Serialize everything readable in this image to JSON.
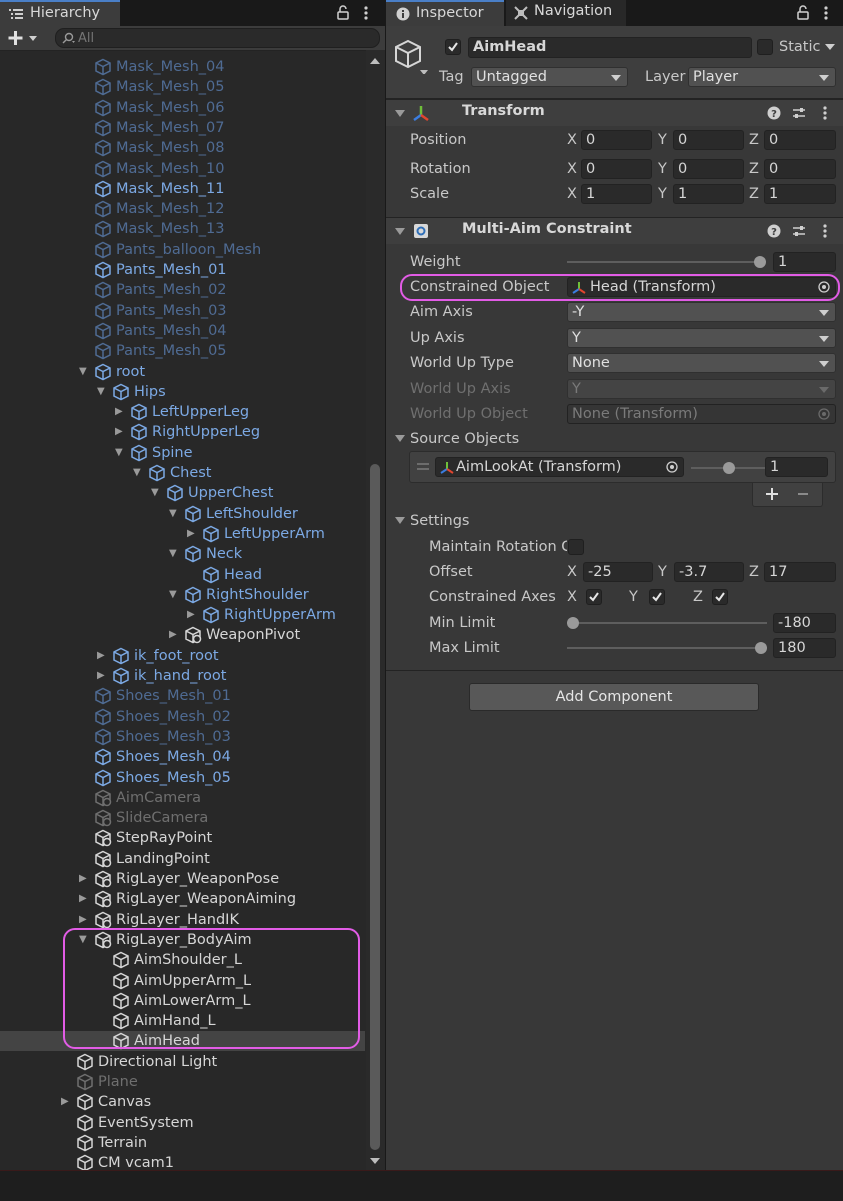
{
  "hierarchy": {
    "tab_label": "Hierarchy",
    "search_placeholder": "All",
    "rows": [
      {
        "label": "Mask_Mesh_04",
        "indent": 0,
        "color": "dblue",
        "arrow": "",
        "icon": "cube"
      },
      {
        "label": "Mask_Mesh_05",
        "indent": 0,
        "color": "dblue",
        "arrow": "",
        "icon": "cube"
      },
      {
        "label": "Mask_Mesh_06",
        "indent": 0,
        "color": "dblue",
        "arrow": "",
        "icon": "cube"
      },
      {
        "label": "Mask_Mesh_07",
        "indent": 0,
        "color": "dblue",
        "arrow": "",
        "icon": "cube"
      },
      {
        "label": "Mask_Mesh_08",
        "indent": 0,
        "color": "dblue",
        "arrow": "",
        "icon": "cube"
      },
      {
        "label": "Mask_Mesh_10",
        "indent": 0,
        "color": "dblue",
        "arrow": "",
        "icon": "cube"
      },
      {
        "label": "Mask_Mesh_11",
        "indent": 0,
        "color": "blue",
        "arrow": "",
        "icon": "cube"
      },
      {
        "label": "Mask_Mesh_12",
        "indent": 0,
        "color": "dblue",
        "arrow": "",
        "icon": "cube"
      },
      {
        "label": "Mask_Mesh_13",
        "indent": 0,
        "color": "dblue",
        "arrow": "",
        "icon": "cube"
      },
      {
        "label": "Pants_balloon_Mesh",
        "indent": 0,
        "color": "dblue",
        "arrow": "",
        "icon": "cube"
      },
      {
        "label": "Pants_Mesh_01",
        "indent": 0,
        "color": "blue",
        "arrow": "",
        "icon": "cube"
      },
      {
        "label": "Pants_Mesh_02",
        "indent": 0,
        "color": "dblue",
        "arrow": "",
        "icon": "cube"
      },
      {
        "label": "Pants_Mesh_03",
        "indent": 0,
        "color": "dblue",
        "arrow": "",
        "icon": "cube"
      },
      {
        "label": "Pants_Mesh_04",
        "indent": 0,
        "color": "dblue",
        "arrow": "",
        "icon": "cube"
      },
      {
        "label": "Pants_Mesh_05",
        "indent": 0,
        "color": "dblue",
        "arrow": "",
        "icon": "cube"
      },
      {
        "label": "root",
        "indent": 0,
        "color": "blue",
        "arrow": "down",
        "icon": "cube"
      },
      {
        "label": "Hips",
        "indent": 1,
        "color": "blue",
        "arrow": "down",
        "icon": "cube"
      },
      {
        "label": "LeftUpperLeg",
        "indent": 2,
        "color": "blue",
        "arrow": "right",
        "icon": "cube"
      },
      {
        "label": "RightUpperLeg",
        "indent": 2,
        "color": "blue",
        "arrow": "right",
        "icon": "cube"
      },
      {
        "label": "Spine",
        "indent": 2,
        "color": "blue",
        "arrow": "down",
        "icon": "cube"
      },
      {
        "label": "Chest",
        "indent": 3,
        "color": "blue",
        "arrow": "down",
        "icon": "cube"
      },
      {
        "label": "UpperChest",
        "indent": 4,
        "color": "blue",
        "arrow": "down",
        "icon": "cube"
      },
      {
        "label": "LeftShoulder",
        "indent": 5,
        "color": "blue",
        "arrow": "down",
        "icon": "cube"
      },
      {
        "label": "LeftUpperArm",
        "indent": 6,
        "color": "blue",
        "arrow": "right",
        "icon": "cube"
      },
      {
        "label": "Neck",
        "indent": 5,
        "color": "blue",
        "arrow": "down",
        "icon": "cube"
      },
      {
        "label": "Head",
        "indent": 6,
        "color": "blue",
        "arrow": "",
        "icon": "cube"
      },
      {
        "label": "RightShoulder",
        "indent": 5,
        "color": "blue",
        "arrow": "down",
        "icon": "cube"
      },
      {
        "label": "RightUpperArm",
        "indent": 6,
        "color": "blue",
        "arrow": "right",
        "icon": "cube"
      },
      {
        "label": "WeaponPivot",
        "indent": 5,
        "color": "white",
        "arrow": "right",
        "icon": "cube-gear"
      },
      {
        "label": "ik_foot_root",
        "indent": 1,
        "color": "blue",
        "arrow": "right",
        "icon": "cube"
      },
      {
        "label": "ik_hand_root",
        "indent": 1,
        "color": "blue",
        "arrow": "right",
        "icon": "cube"
      },
      {
        "label": "Shoes_Mesh_01",
        "indent": 0,
        "color": "dblue",
        "arrow": "",
        "icon": "cube"
      },
      {
        "label": "Shoes_Mesh_02",
        "indent": 0,
        "color": "dblue",
        "arrow": "",
        "icon": "cube"
      },
      {
        "label": "Shoes_Mesh_03",
        "indent": 0,
        "color": "dblue",
        "arrow": "",
        "icon": "cube"
      },
      {
        "label": "Shoes_Mesh_04",
        "indent": 0,
        "color": "blue",
        "arrow": "",
        "icon": "cube"
      },
      {
        "label": "Shoes_Mesh_05",
        "indent": 0,
        "color": "blue",
        "arrow": "",
        "icon": "cube"
      },
      {
        "label": "AimCamera",
        "indent": 0,
        "color": "gray",
        "arrow": "",
        "icon": "cube-gear"
      },
      {
        "label": "SlideCamera",
        "indent": 0,
        "color": "gray",
        "arrow": "",
        "icon": "cube-gear"
      },
      {
        "label": "StepRayPoint",
        "indent": 0,
        "color": "white",
        "arrow": "",
        "icon": "cube-gear"
      },
      {
        "label": "LandingPoint",
        "indent": 0,
        "color": "white",
        "arrow": "",
        "icon": "cube-gear"
      },
      {
        "label": "RigLayer_WeaponPose",
        "indent": 0,
        "color": "white",
        "arrow": "right",
        "icon": "cube-gear"
      },
      {
        "label": "RigLayer_WeaponAiming",
        "indent": 0,
        "color": "white",
        "arrow": "right",
        "icon": "cube-gear"
      },
      {
        "label": "RigLayer_HandIK",
        "indent": 0,
        "color": "white",
        "arrow": "right",
        "icon": "cube-gear"
      },
      {
        "label": "RigLayer_BodyAim",
        "indent": 0,
        "color": "white",
        "arrow": "down",
        "icon": "cube-gear"
      },
      {
        "label": "AimShoulder_L",
        "indent": 1,
        "color": "white",
        "arrow": "",
        "icon": "cube"
      },
      {
        "label": "AimUpperArm_L",
        "indent": 1,
        "color": "white",
        "arrow": "",
        "icon": "cube"
      },
      {
        "label": "AimLowerArm_L",
        "indent": 1,
        "color": "white",
        "arrow": "",
        "icon": "cube"
      },
      {
        "label": "AimHand_L",
        "indent": 1,
        "color": "white",
        "arrow": "",
        "icon": "cube"
      },
      {
        "label": "AimHead",
        "indent": 1,
        "color": "white",
        "arrow": "",
        "icon": "cube",
        "selected": true
      },
      {
        "label": "Directional Light",
        "indent": -1,
        "color": "white",
        "arrow": "",
        "icon": "cube"
      },
      {
        "label": "Plane",
        "indent": -1,
        "color": "gray",
        "arrow": "",
        "icon": "cube"
      },
      {
        "label": "Canvas",
        "indent": -1,
        "color": "white",
        "arrow": "right",
        "icon": "cube"
      },
      {
        "label": "EventSystem",
        "indent": -1,
        "color": "white",
        "arrow": "",
        "icon": "cube"
      },
      {
        "label": "Terrain",
        "indent": -1,
        "color": "white",
        "arrow": "",
        "icon": "cube"
      },
      {
        "label": "CM vcam1",
        "indent": -1,
        "color": "white",
        "arrow": "",
        "icon": "cube"
      }
    ]
  },
  "inspector": {
    "tab_label": "Inspector",
    "nav_tab_label": "Navigation",
    "object_name": "AimHead",
    "static_label": "Static",
    "tag_label": "Tag",
    "tag_value": "Untagged",
    "layer_label": "Layer",
    "layer_value": "Player",
    "transform": {
      "title": "Transform",
      "position_label": "Position",
      "rotation_label": "Rotation",
      "scale_label": "Scale",
      "position": {
        "x": "0",
        "y": "0",
        "z": "0"
      },
      "rotation": {
        "x": "0",
        "y": "0",
        "z": "0"
      },
      "scale": {
        "x": "1",
        "y": "1",
        "z": "1"
      }
    },
    "axis_x": "X",
    "axis_y": "Y",
    "axis_z": "Z",
    "constraint": {
      "title": "Multi-Aim Constraint",
      "weight_label": "Weight",
      "weight_value": "1",
      "weight_fraction": 1.0,
      "constrained_object_label": "Constrained Object",
      "constrained_object_value": "Head (Transform)",
      "aim_axis_label": "Aim Axis",
      "aim_axis_value": "-Y",
      "up_axis_label": "Up Axis",
      "up_axis_value": "Y",
      "world_up_type_label": "World Up Type",
      "world_up_type_value": "None",
      "world_up_axis_label": "World Up Axis",
      "world_up_axis_value": "Y",
      "world_up_object_label": "World Up Object",
      "world_up_object_value": "None (Transform)",
      "source_objects_label": "Source Objects",
      "source_object_value": "AimLookAt (Transform)",
      "source_weight_value": "1",
      "source_weight_fraction": 1.0,
      "settings_label": "Settings",
      "maintain_label": "Maintain Rotation C",
      "offset_label": "Offset",
      "offset": {
        "x": "-25",
        "y": "-3.7",
        "z": "17"
      },
      "constrained_axes_label": "Constrained Axes",
      "min_limit_label": "Min Limit",
      "min_limit_value": "-180",
      "max_limit_label": "Max Limit",
      "max_limit_value": "180"
    },
    "add_component_label": "Add Component"
  },
  "colors": {
    "highlight": "#e25ce6",
    "accent_tab": "#4a7fc7",
    "prefab_blue": "#7ca9e4",
    "prefab_blue_dim": "#4f6b93"
  }
}
